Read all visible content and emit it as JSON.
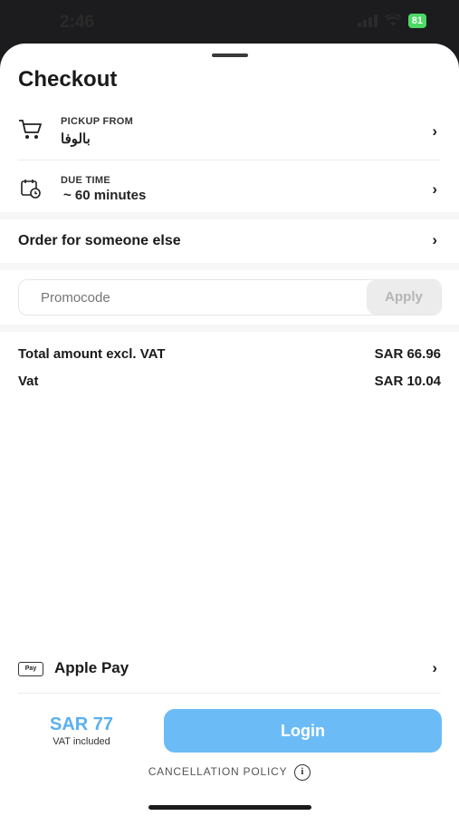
{
  "status_bar": {
    "time": "2:46",
    "battery": "81"
  },
  "header": {
    "title": "Checkout"
  },
  "pickup": {
    "label": "PICKUP FROM",
    "value": "بالوفا"
  },
  "due_time": {
    "label": "DUE TIME",
    "value": "~ 60 minutes"
  },
  "order_for_someone": {
    "label": "Order for someone else"
  },
  "promo": {
    "placeholder": "Promocode",
    "apply_label": "Apply"
  },
  "totals": {
    "excl_vat_label": "Total amount excl. VAT",
    "excl_vat_value": "SAR 66.96",
    "vat_label": "Vat",
    "vat_value": "SAR 10.04"
  },
  "payment": {
    "badge": "Pay",
    "label": "Apple Pay"
  },
  "footer": {
    "price": "SAR 77",
    "vat_note": "VAT included",
    "login_label": "Login",
    "cancellation_label": "CANCELLATION POLICY"
  },
  "icons": {
    "chevron": "chevron-right-icon",
    "cart": "cart-icon",
    "calendar": "calendar-clock-icon",
    "info": "info-icon"
  },
  "colors": {
    "accent": "#6bbcf6",
    "price": "#5ab0f0"
  }
}
